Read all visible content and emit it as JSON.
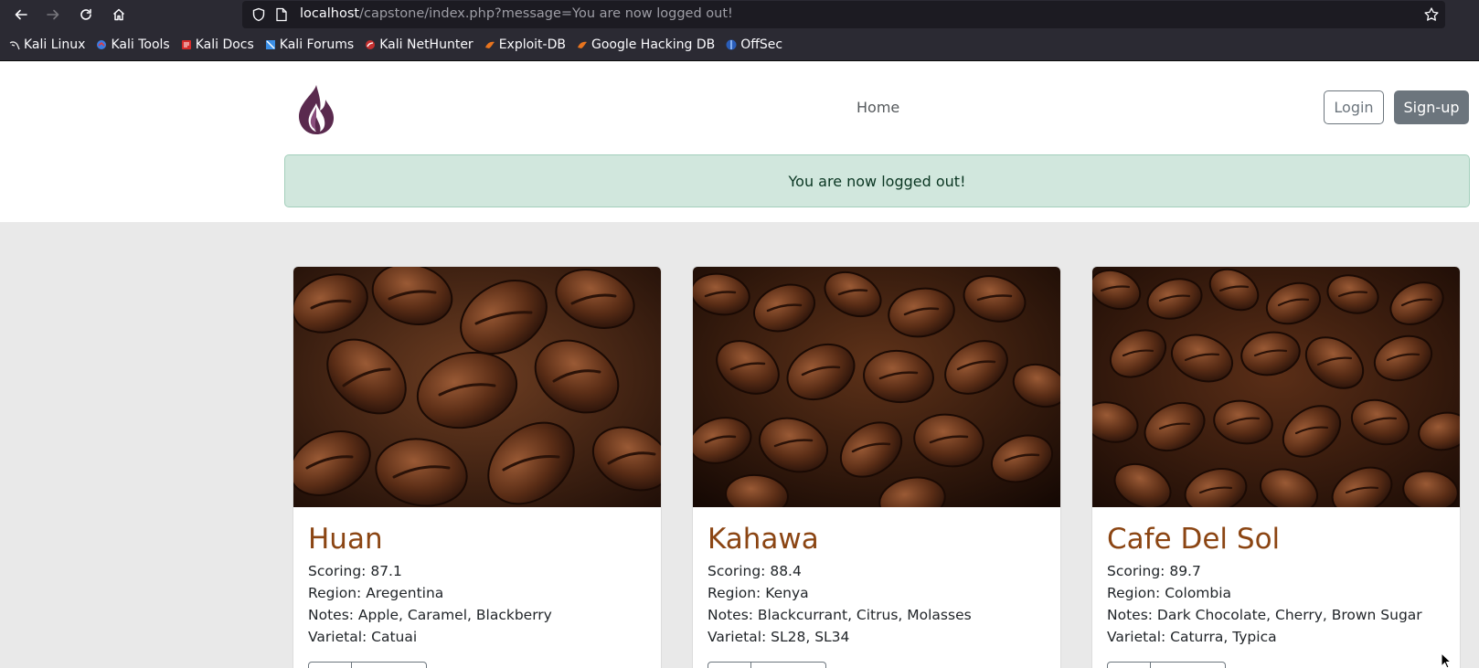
{
  "browser": {
    "url_host": "localhost",
    "url_path": "/capstone/index.php?message=You are now logged out!",
    "bookmarks": [
      "Kali Linux",
      "Kali Tools",
      "Kali Docs",
      "Kali Forums",
      "Kali NetHunter",
      "Exploit-DB",
      "Google Hacking DB",
      "OffSec"
    ]
  },
  "header": {
    "nav_home": "Home",
    "login_label": "Login",
    "signup_label": "Sign-up"
  },
  "alert": {
    "message": "You are now logged out!"
  },
  "cards": [
    {
      "title": "Huan",
      "scoring": "Scoring: 87.1",
      "region": "Region: Aregentina",
      "notes": "Notes: Apple, Caramel, Blackberry",
      "varietal": "Varietal: Catuai"
    },
    {
      "title": "Kahawa",
      "scoring": "Scoring: 88.4",
      "region": "Region: Kenya",
      "notes": "Notes: Blackcurrant, Citrus, Molasses",
      "varietal": "Varietal: SL28, SL34"
    },
    {
      "title": "Cafe Del Sol",
      "scoring": "Scoring: 89.7",
      "region": "Region: Colombia",
      "notes": "Notes: Dark Chocolate, Cherry, Brown Sugar",
      "varietal": "Varietal: Caturra, Typica"
    }
  ],
  "colors": {
    "title_brown": "#8b4513",
    "alert_bg": "#d1e7dd",
    "button_gray": "#6c757d"
  }
}
